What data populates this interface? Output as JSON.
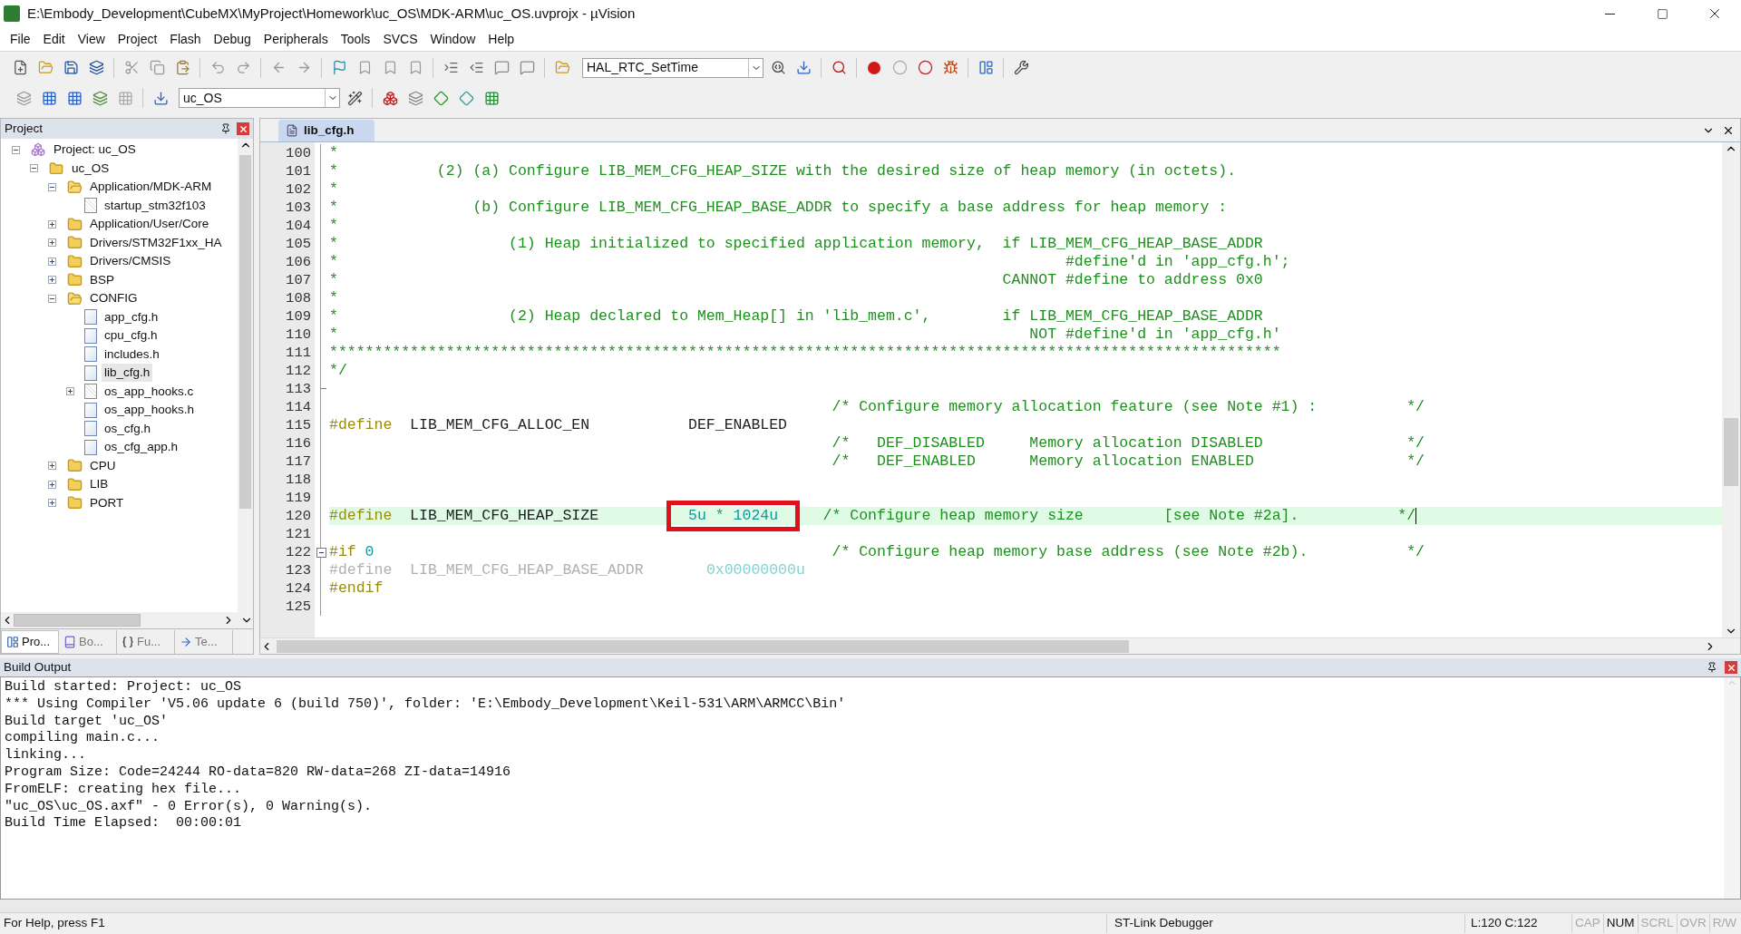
{
  "window": {
    "title": "E:\\Embody_Development\\CubeMX\\MyProject\\Homework\\uc_OS\\MDK-ARM\\uc_OS.uvprojx - µVision"
  },
  "menu": [
    "File",
    "Edit",
    "View",
    "Project",
    "Flash",
    "Debug",
    "Peripherals",
    "Tools",
    "SVCS",
    "Window",
    "Help"
  ],
  "toolbar": {
    "function_combo": "HAL_RTC_SetTime",
    "target_combo": "uc_OS"
  },
  "project_panel": {
    "title": "Project",
    "tree": [
      {
        "label": "Project: uc_OS",
        "kind": "project",
        "expanded": true,
        "children": [
          {
            "label": "uc_OS",
            "kind": "target",
            "expanded": true,
            "children": [
              {
                "label": "Application/MDK-ARM",
                "kind": "folder",
                "expanded": true,
                "children": [
                  {
                    "label": "startup_stm32f103",
                    "kind": "source",
                    "selected": false
                  }
                ]
              },
              {
                "label": "Application/User/Core",
                "kind": "folder",
                "expanded": false
              },
              {
                "label": "Drivers/STM32F1xx_HA",
                "kind": "folder",
                "expanded": false
              },
              {
                "label": "Drivers/CMSIS",
                "kind": "folder",
                "expanded": false
              },
              {
                "label": "BSP",
                "kind": "folder",
                "expanded": false
              },
              {
                "label": "CONFIG",
                "kind": "folder",
                "expanded": true,
                "children": [
                  {
                    "label": "app_cfg.h",
                    "kind": "header",
                    "selected": false
                  },
                  {
                    "label": "cpu_cfg.h",
                    "kind": "header",
                    "selected": false
                  },
                  {
                    "label": "includes.h",
                    "kind": "header",
                    "selected": false
                  },
                  {
                    "label": "lib_cfg.h",
                    "kind": "header",
                    "selected": true
                  },
                  {
                    "label": "os_app_hooks.c",
                    "kind": "source",
                    "expanded": false,
                    "selected": false
                  },
                  {
                    "label": "os_app_hooks.h",
                    "kind": "header",
                    "selected": false
                  },
                  {
                    "label": "os_cfg.h",
                    "kind": "header",
                    "selected": false
                  },
                  {
                    "label": "os_cfg_app.h",
                    "kind": "header",
                    "selected": false
                  }
                ]
              },
              {
                "label": "CPU",
                "kind": "folder",
                "expanded": false
              },
              {
                "label": "LIB",
                "kind": "folder",
                "expanded": false
              },
              {
                "label": "PORT",
                "kind": "folder",
                "expanded": false
              }
            ]
          }
        ]
      }
    ],
    "tabs": [
      {
        "label": "Pro...",
        "kind": "project",
        "selected": true
      },
      {
        "label": "Bo...",
        "kind": "books",
        "selected": false
      },
      {
        "label": "Fu...",
        "kind": "functions",
        "selected": false
      },
      {
        "label": "Te...",
        "kind": "templates",
        "selected": false
      }
    ]
  },
  "editor": {
    "tabs": [
      {
        "label": "lib_cfg.h",
        "selected": true
      }
    ],
    "lines": [
      {
        "number": "100",
        "segments": [
          {
            "kind": "comment",
            "text": "*"
          }
        ]
      },
      {
        "number": "101",
        "segments": [
          {
            "kind": "comment",
            "text": "*           (2) (a) Configure LIB_MEM_CFG_HEAP_SIZE with the desired size of heap memory (in octets)."
          }
        ]
      },
      {
        "number": "102",
        "segments": [
          {
            "kind": "comment",
            "text": "*"
          }
        ]
      },
      {
        "number": "103",
        "segments": [
          {
            "kind": "comment",
            "text": "*               (b) Configure LIB_MEM_CFG_HEAP_BASE_ADDR to specify a base address for heap memory :"
          }
        ]
      },
      {
        "number": "104",
        "segments": [
          {
            "kind": "comment",
            "text": "*"
          }
        ]
      },
      {
        "number": "105",
        "segments": [
          {
            "kind": "comment",
            "text": "*                   (1) Heap initialized to specified application memory,  if LIB_MEM_CFG_HEAP_BASE_ADDR"
          }
        ]
      },
      {
        "number": "106",
        "segments": [
          {
            "kind": "comment",
            "text": "*                                                                                 #define'd in 'app_cfg.h';"
          }
        ]
      },
      {
        "number": "107",
        "segments": [
          {
            "kind": "comment",
            "text": "*                                                                          CANNOT #define to address 0x0"
          }
        ]
      },
      {
        "number": "108",
        "segments": [
          {
            "kind": "comment",
            "text": "*"
          }
        ]
      },
      {
        "number": "109",
        "segments": [
          {
            "kind": "comment",
            "text": "*                   (2) Heap declared to Mem_Heap[] in 'lib_mem.c',        if LIB_MEM_CFG_HEAP_BASE_ADDR"
          }
        ]
      },
      {
        "number": "110",
        "segments": [
          {
            "kind": "comment",
            "text": "*                                                                             NOT #define'd in 'app_cfg.h'"
          }
        ]
      },
      {
        "number": "111",
        "segments": [
          {
            "kind": "comment",
            "text": "**********************************************************************************************************"
          }
        ]
      },
      {
        "number": "112",
        "segments": [
          {
            "kind": "comment",
            "text": "*/"
          }
        ]
      },
      {
        "number": "113",
        "fold_end": true
      },
      {
        "number": "114",
        "segments": [
          {
            "kind": "comment",
            "text": "                                                        /* Configure memory allocation feature (see Note #1) :          */"
          }
        ]
      },
      {
        "number": "115",
        "segments": [
          {
            "kind": "directive",
            "text": "#define"
          },
          {
            "kind": "plain",
            "text": "  LIB_MEM_CFG_ALLOC_EN           DEF_ENABLED"
          }
        ]
      },
      {
        "number": "116",
        "segments": [
          {
            "kind": "comment",
            "text": "                                                        /*   DEF_DISABLED     Memory allocation DISABLED                */"
          }
        ]
      },
      {
        "number": "117",
        "segments": [
          {
            "kind": "comment",
            "text": "                                                        /*   DEF_ENABLED      Memory allocation ENABLED                 */"
          }
        ]
      },
      {
        "number": "118"
      },
      {
        "number": "119"
      },
      {
        "number": "120",
        "current": true,
        "segments": [
          {
            "kind": "directive",
            "text": "#define"
          },
          {
            "kind": "plain",
            "text": "  LIB_MEM_CFG_HEAP_SIZE        "
          },
          {
            "kind": "number",
            "text": "  5u * 1024u  ",
            "boxed": true
          },
          {
            "kind": "comment",
            "text": "   /* Configure heap memory size         [see Note #2a].           */"
          }
        ]
      },
      {
        "number": "121"
      },
      {
        "number": "122",
        "fold_start": true,
        "segments": [
          {
            "kind": "directive",
            "text": "#if"
          },
          {
            "kind": "number",
            "text": " 0"
          },
          {
            "kind": "comment",
            "text": "                                                   /* Configure heap memory base address (see Note #2b).           */"
          }
        ]
      },
      {
        "number": "123",
        "segments": [
          {
            "kind": "inactive",
            "text": "#define  LIB_MEM_CFG_HEAP_BASE_ADDR       "
          },
          {
            "kind": "inactive_number",
            "text": "0x00000000u"
          }
        ]
      },
      {
        "number": "124",
        "segments": [
          {
            "kind": "directive",
            "text": "#endif"
          }
        ]
      },
      {
        "number": "125"
      }
    ]
  },
  "build_output": {
    "title": "Build Output",
    "lines": [
      "Build started: Project: uc_OS",
      "*** Using Compiler 'V5.06 update 6 (build 750)', folder: 'E:\\Embody_Development\\Keil-531\\ARM\\ARMCC\\Bin'",
      "Build target 'uc_OS'",
      "compiling main.c...",
      "linking...",
      "Program Size: Code=24244 RO-data=820 RW-data=268 ZI-data=14916",
      "FromELF: creating hex file...",
      "\"uc_OS\\uc_OS.axf\" - 0 Error(s), 0 Warning(s).",
      "Build Time Elapsed:  00:00:01"
    ]
  },
  "status_bar": {
    "help": "For Help, press F1",
    "debugger": "ST-Link Debugger",
    "position": "L:120 C:122",
    "indicators": [
      {
        "label": "CAP",
        "on": false
      },
      {
        "label": "NUM",
        "on": true
      },
      {
        "label": "SCRL",
        "on": false
      },
      {
        "label": "OVR",
        "on": false
      },
      {
        "label": "R/W",
        "on": false
      }
    ]
  }
}
